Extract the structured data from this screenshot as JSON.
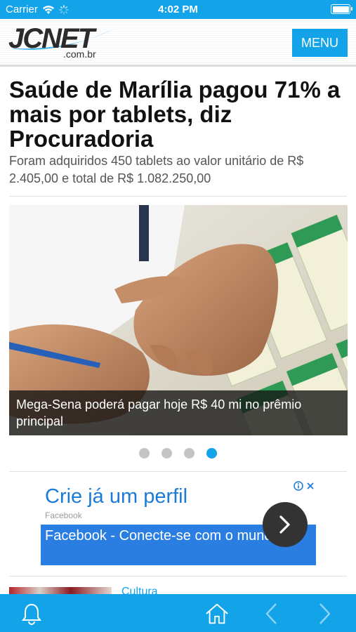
{
  "status_bar": {
    "carrier": "Carrier",
    "time": "4:02 PM",
    "icons": [
      "wifi-icon",
      "activity-spinner-icon",
      "battery-icon"
    ]
  },
  "header": {
    "logo": "JCNET .com.br",
    "menu_label": "MENU"
  },
  "article": {
    "headline": "Saúde de Marília pagou 71% a mais por tablets, diz Procuradoria",
    "summary": "Foram adquiridos 450 tablets ao valor unitário de R$ 2.405,00 e total de R$ 1.082.250,00"
  },
  "carousel": {
    "caption": "Mega-Sena poderá pagar hoje R$ 40 mi no prêmio principal",
    "slide_count": 4,
    "active_slide": 4
  },
  "ad": {
    "title": "Crie já um perfil",
    "source": "Facebook",
    "cta": "Facebook - Conecte-se com o mundo",
    "icons": [
      "ad-info-icon",
      "ad-close-icon",
      "chevron-right-icon"
    ]
  },
  "next_item": {
    "category": "Cultura"
  },
  "tab_bar": {
    "icons": [
      "bell-icon",
      "home-icon",
      "back-arrow-icon",
      "forward-arrow-icon"
    ]
  },
  "colors": {
    "accent": "#12a3e8",
    "ad_blue": "#2a7de1",
    "ad_title": "#1b7bd6"
  }
}
